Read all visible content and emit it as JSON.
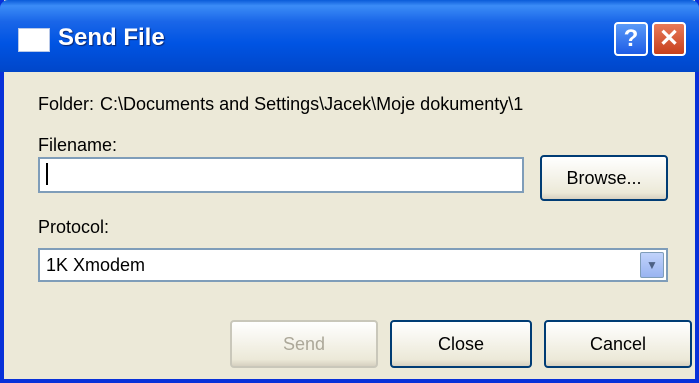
{
  "window": {
    "title": "Send File",
    "help_label": "?",
    "close_label": "✕"
  },
  "folder": {
    "label": "Folder:",
    "value": "C:\\Documents and Settings\\Jacek\\Moje dokumenty\\1"
  },
  "filename": {
    "label": "Filename:",
    "value": ""
  },
  "buttons": {
    "browse": "Browse...",
    "send": "Send",
    "close": "Close",
    "cancel": "Cancel"
  },
  "protocol": {
    "label": "Protocol:",
    "selected": "1K Xmodem"
  },
  "colors": {
    "titlebar": "#0054e3",
    "face": "#ece9d8",
    "disabled_text": "#aca899"
  }
}
